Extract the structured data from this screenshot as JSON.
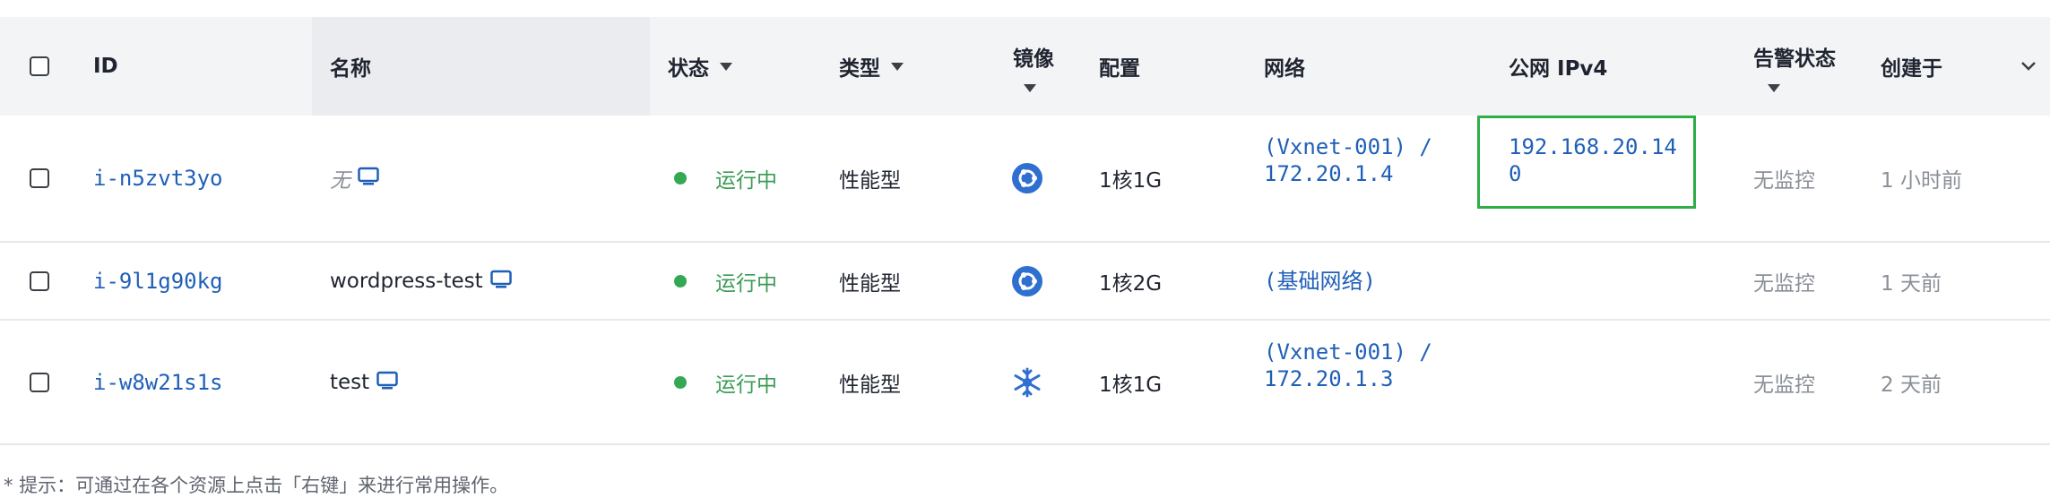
{
  "columns": {
    "id": "ID",
    "name": "名称",
    "status": "状态",
    "type": "类型",
    "image": "镜像",
    "config": "配置",
    "network": "网络",
    "public_ip": "公网 IPv4",
    "alert": "告警状态",
    "created": "创建于"
  },
  "rows": [
    {
      "id": "i-n5zvt3yo",
      "name": "无",
      "status": "运行中",
      "type": "性能型",
      "image_icon": "ubuntu-icon",
      "config": "1核1G",
      "network_line1": "(Vxnet-001) /",
      "network_line2": "172.20.1.4",
      "public_ip_line1": "192.168.20.14",
      "public_ip_line2": "0",
      "alert": "无监控",
      "created": "1 小时前"
    },
    {
      "id": "i-9l1g90kg",
      "name": "wordpress-test",
      "status": "运行中",
      "type": "性能型",
      "image_icon": "ubuntu-icon",
      "config": "1核2G",
      "network_line1": "(基础网络)",
      "network_line2": "",
      "public_ip_line1": "",
      "public_ip_line2": "",
      "alert": "无监控",
      "created": "1 天前"
    },
    {
      "id": "i-w8w21s1s",
      "name": "test",
      "status": "运行中",
      "type": "性能型",
      "image_icon": "snowflake-os-icon",
      "config": "1核1G",
      "network_line1": "(Vxnet-001) /",
      "network_line2": "172.20.1.3",
      "public_ip_line1": "",
      "public_ip_line2": "",
      "alert": "无监控",
      "created": "2 天前"
    }
  ],
  "tip": "* 提示：可通过在各个资源上点击「右键」来进行常用操作。",
  "colors": {
    "link": "#1f5fb8",
    "status_running": "#34a853",
    "highlight_box": "#2fae48"
  }
}
